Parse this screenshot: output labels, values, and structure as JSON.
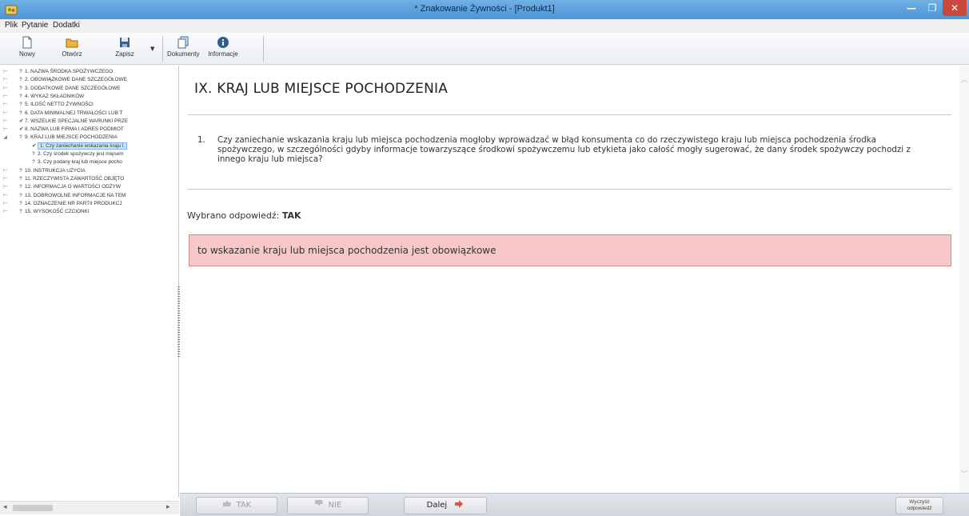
{
  "window": {
    "title": "* Znakowanie Żywności - [Produkt1]",
    "close_glyph": "✕",
    "min_glyph": "—",
    "max_glyph": "❐"
  },
  "menu": [
    "Plik",
    "Pytanie",
    "Dodatki"
  ],
  "toolbar": {
    "new_label": "Nowy",
    "open_label": "Otwórz",
    "save_label": "Zapisz",
    "documents_label": "Dokumenty",
    "info_label": "Informacje",
    "dropdown_glyph": "▼"
  },
  "tree": {
    "items": [
      {
        "prefix": "⊢",
        "mark": "?",
        "label": "1. NAZWA ŚRODKA SPOŻYWCZEGO"
      },
      {
        "prefix": "⊢",
        "mark": "?",
        "label": "2. OBOWIĄZKOWE DANE SZCZEGÓŁOWE"
      },
      {
        "prefix": "⊢",
        "mark": "?",
        "label": "3. DODATKOWE DANE SZCZEGÓŁOWE"
      },
      {
        "prefix": "⊢",
        "mark": "?",
        "label": "4. WYKAZ SKŁADNIKÓW"
      },
      {
        "prefix": "⊢",
        "mark": "?",
        "label": "5. ILOŚĆ NETTO ŻYWNOŚCI"
      },
      {
        "prefix": "⊢",
        "mark": "?",
        "label": "6. DATA MINIMALNEJ TRWAŁOŚCI LUB T"
      },
      {
        "prefix": "⊢",
        "mark": "✔",
        "label": "7. WSZELKIE SPECJALNE WARUNKI PRZE"
      },
      {
        "prefix": "⊢",
        "mark": "✔",
        "label": "8. NAZWA LUB FIRMA I ADRES PODMIOT"
      },
      {
        "prefix": "◢",
        "mark": "?",
        "label": "9. KRAJ LUB MIEJSCE POCHODZENIA"
      },
      {
        "prefix": "",
        "mark": "✔",
        "label": "1. Czy zaniechanie wskazania kraju l."
      },
      {
        "prefix": "",
        "mark": "?",
        "label": "2. Czy środek spożywczy jest mięsem"
      },
      {
        "prefix": "",
        "mark": "?",
        "label": "3. Czy podany kraj lub miejsce pocho"
      },
      {
        "prefix": "⊢",
        "mark": "?",
        "label": "10. INSTRUKCJA UŻYCIA"
      },
      {
        "prefix": "⊢",
        "mark": "?",
        "label": "11. RZECZYWISTA ZAWARTOŚĆ OBJĘTO"
      },
      {
        "prefix": "⊢",
        "mark": "?",
        "label": "12. INFORMACJA O WARTOŚCI ODŻYW"
      },
      {
        "prefix": "⊢",
        "mark": "?",
        "label": "13. DOBROWOLNE INFORMACJE NA TEM"
      },
      {
        "prefix": "⊢",
        "mark": "?",
        "label": "14. OZNACZENIE NR PARTII PRODUKCJ"
      },
      {
        "prefix": "⊢",
        "mark": "?",
        "label": "15. WYSOKOŚĆ CZCIONKI"
      }
    ],
    "scroll_left": "◂",
    "scroll_right": "▸"
  },
  "content": {
    "heading": "IX. KRAJ LUB MIEJSCE POCHODZENIA",
    "question_number": "1.",
    "question_text": "Czy zaniechanie wskazania kraju lub miejsca pochodzenia mogłoby wprowadzać w błąd konsumenta co do rzeczywistego kraju lub miejsca pochodzenia środka spożywczego, w szczególności gdyby informacje towarzyszące środkowi spożywczemu lub etykieta jako całość mogły sugerować, że dany środek spożywczy pochodzi z innego kraju lub miejsca?",
    "answer_prefix": "Wybrano odpowiedź:",
    "answer_value": "TAK",
    "result_text": "to wskazanie kraju lub miejsca pochodzenia jest obowiązkowe",
    "scroll_up": "︿",
    "scroll_down": "﹀"
  },
  "bottom": {
    "yes_label": "TAK",
    "no_label": "NIE",
    "next_label": "Dalej",
    "clear_label_line1": "Wyczyść",
    "clear_label_line2": "odpowiedź"
  }
}
